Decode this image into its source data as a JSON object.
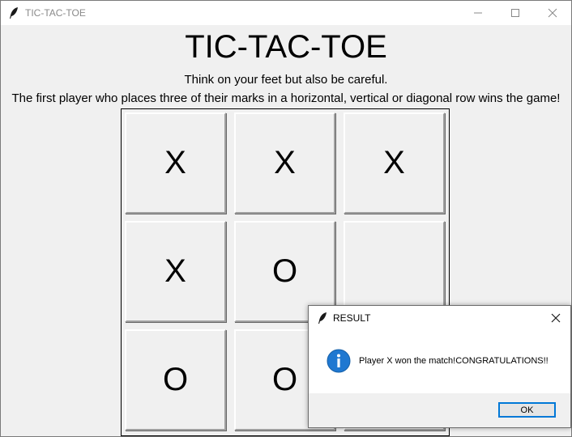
{
  "window": {
    "title": "TIC-TAC-TOE",
    "icon": "feather-icon"
  },
  "game": {
    "title": "TIC-TAC-TOE",
    "subtitle": "Think on your feet but also be careful.",
    "rules": "The first player who places three of their marks in a horizontal, vertical or diagonal row wins the game!",
    "board": [
      [
        "X",
        "X",
        "X"
      ],
      [
        "X",
        "O",
        ""
      ],
      [
        "O",
        "O",
        ""
      ]
    ]
  },
  "dialog": {
    "title": "RESULT",
    "icon": "info-icon",
    "message": "Player X won the match!CONGRATULATIONS!!",
    "ok_label": "OK",
    "accent": "#0078d7"
  }
}
